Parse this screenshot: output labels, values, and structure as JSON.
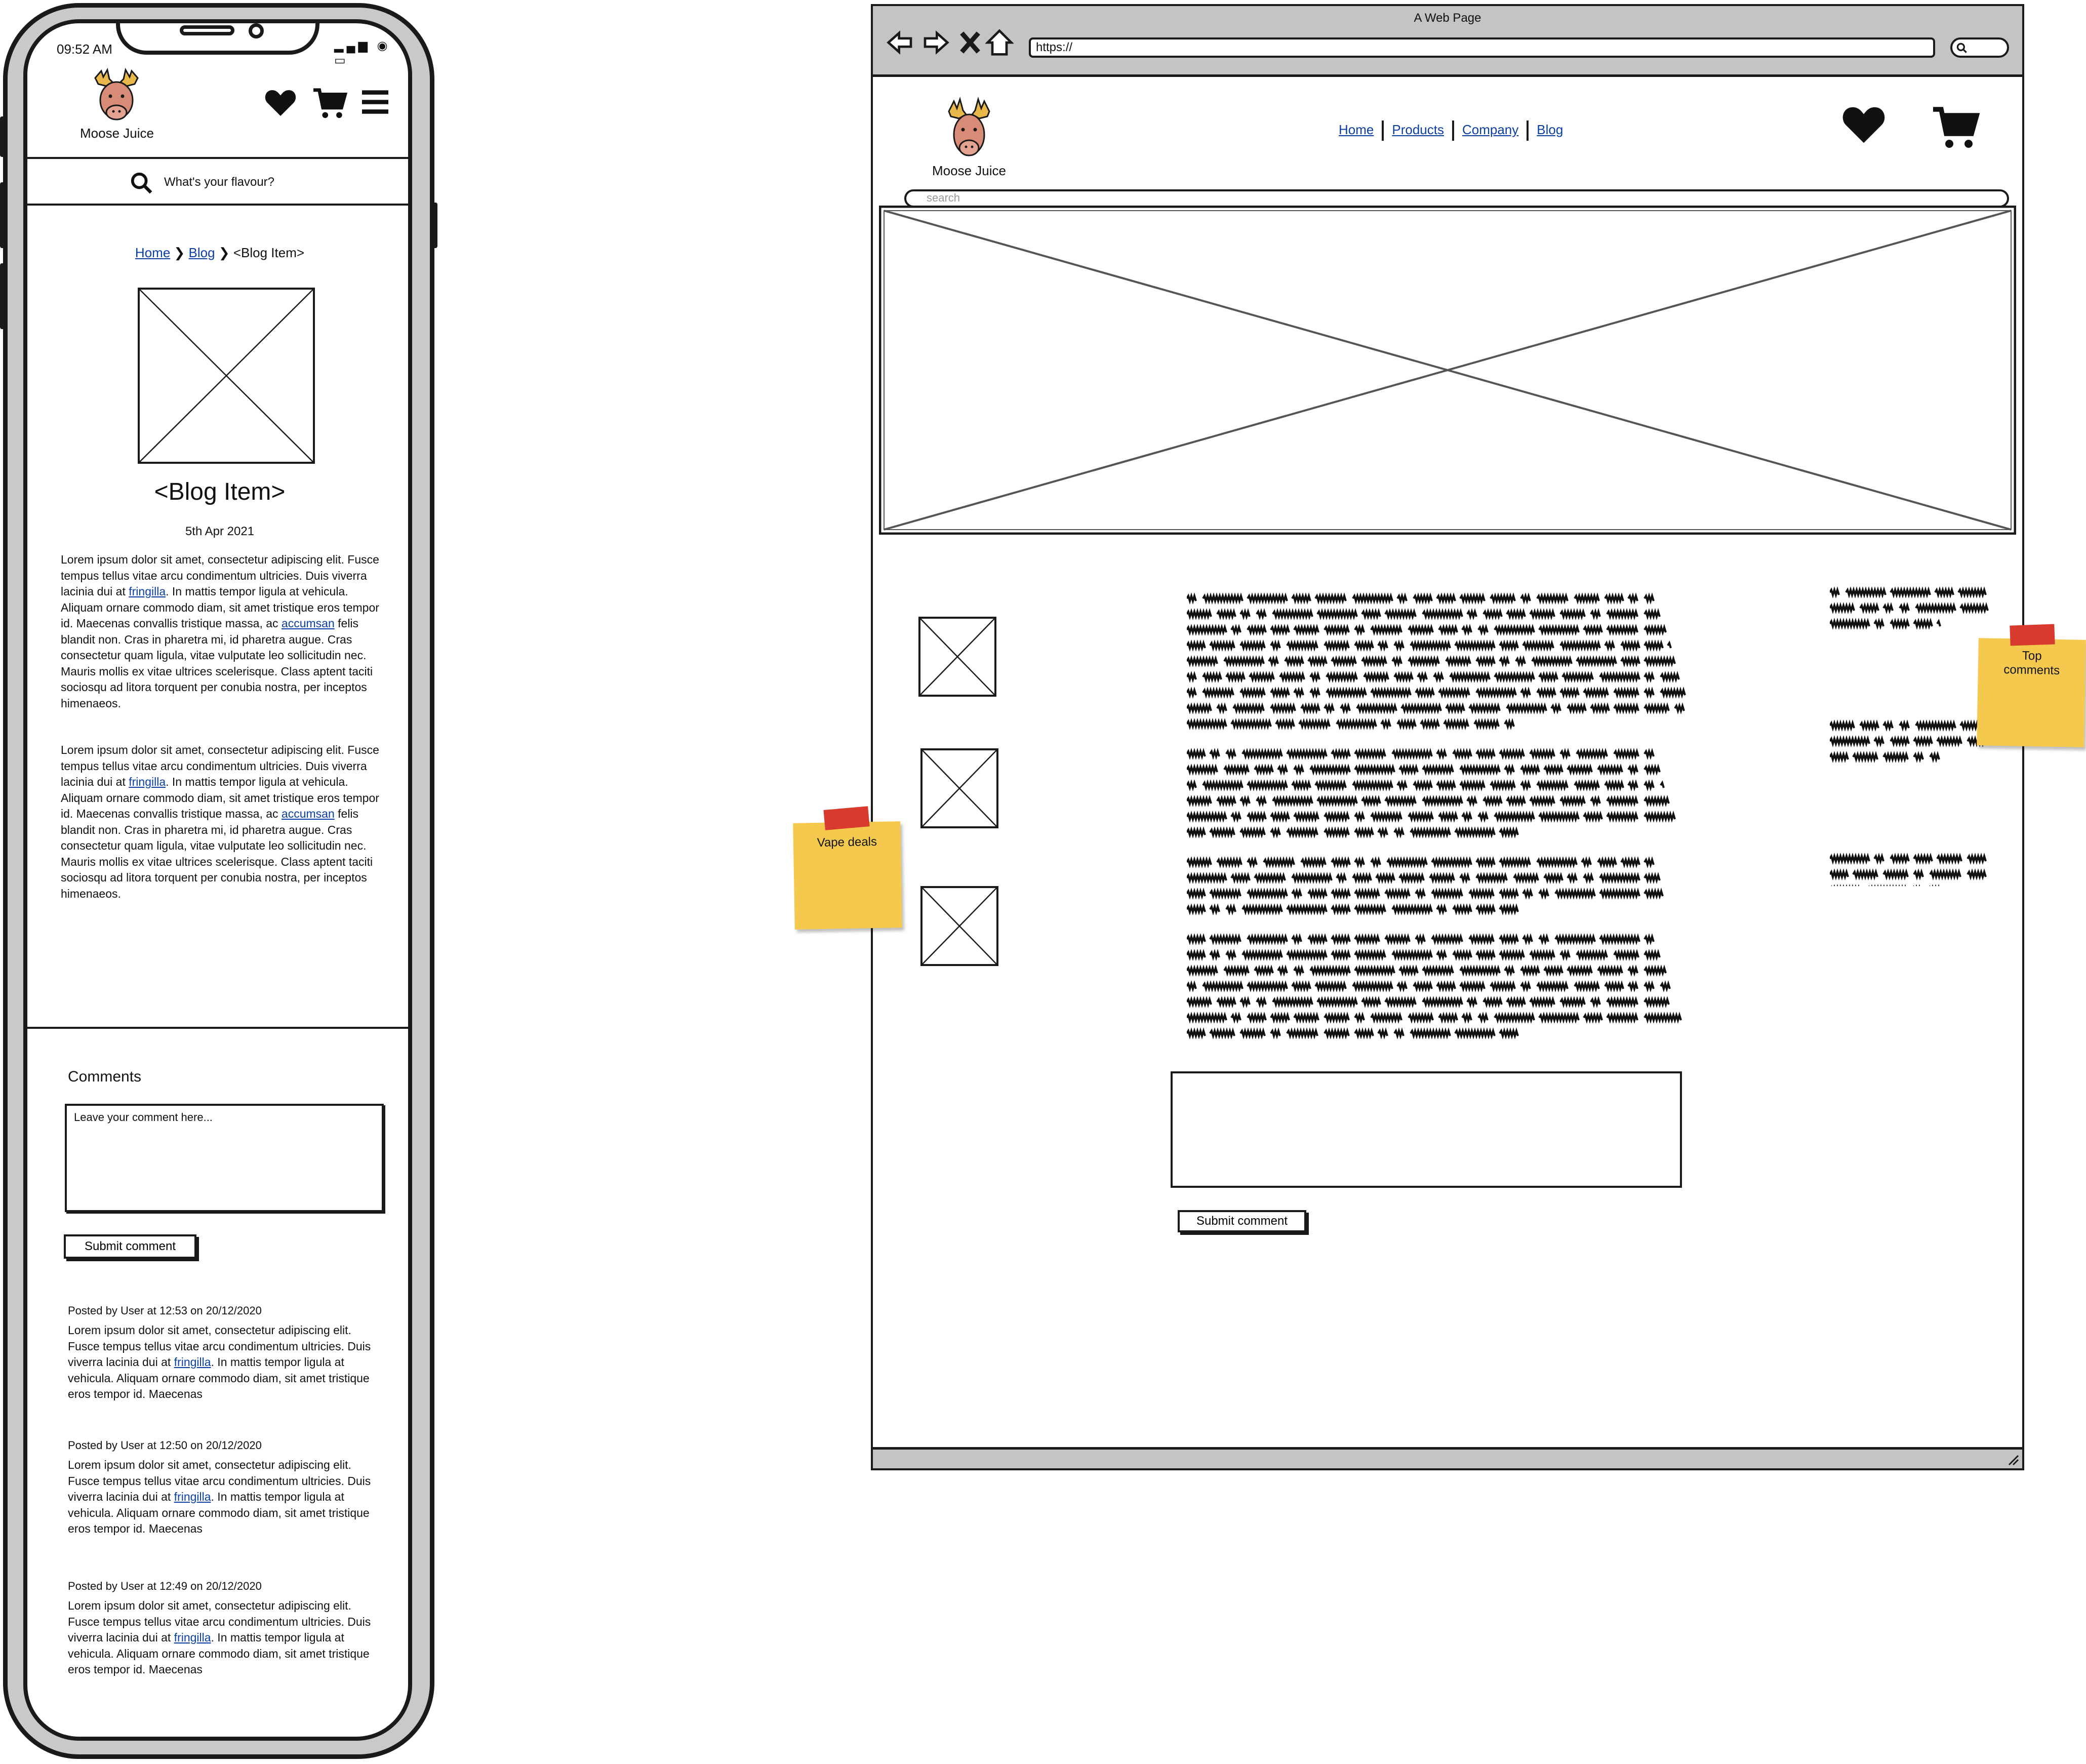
{
  "mobile": {
    "status": {
      "time": "09:52 AM",
      "icons": "▂▄▆ ◉ ▭"
    },
    "brand": "Moose Juice",
    "search_placeholder": "What's your flavour?",
    "breadcrumb": {
      "home": "Home",
      "blog": "Blog",
      "current": "<Blog Item>",
      "sep": "❯"
    },
    "title": "<Blog Item>",
    "date": "5th Apr 2021",
    "paragraph": {
      "part1": "Lorem ipsum dolor sit amet, consectetur adipiscing elit. Fusce tempus tellus vitae arcu condimentum ultricies. Duis viverra lacinia dui at ",
      "link1": "fringilla",
      "part2": ". In mattis tempor ligula at vehicula. Aliquam ornare commodo diam, sit amet tristique eros tempor id. Maecenas convallis tristique massa, ac ",
      "link2": "accumsan",
      "part3": " felis blandit non. Cras in pharetra mi, id pharetra augue. Cras consectetur quam ligula, vitae vulputate leo sollicitudin nec. Mauris mollis ex vitae ultrices scelerisque. Class aptent taciti sociosqu ad litora torquent per conubia nostra, per inceptos himenaeos."
    },
    "comments_heading": "Comments",
    "comment_placeholder": "Leave your comment here...",
    "submit_label": "Submit comment",
    "posts": [
      {
        "meta": "Posted by User at 12:53 on 20/12/2020"
      },
      {
        "meta": "Posted by User at 12:50 on 20/12/2020"
      },
      {
        "meta": "Posted by User at 12:49 on 20/12/2020"
      }
    ],
    "post_text": {
      "part1": "Lorem ipsum dolor sit amet, consectetur adipiscing elit. Fusce tempus tellus vitae arcu condimentum ultricies. Duis viverra lacinia dui at ",
      "link": "fringilla",
      "part2": ". In mattis tempor ligula at vehicula. Aliquam ornare commodo diam, sit amet tristique eros tempor id. Maecenas"
    }
  },
  "desktop": {
    "window_title": "A Web Page",
    "url": "https://",
    "brand": "Moose Juice",
    "nav": [
      "Home",
      "Products",
      "Company",
      "Blog"
    ],
    "search_placeholder": "search",
    "submit_label": "Submit comment"
  },
  "stickies": {
    "vape": "Vape deals",
    "top": "Top comments"
  }
}
